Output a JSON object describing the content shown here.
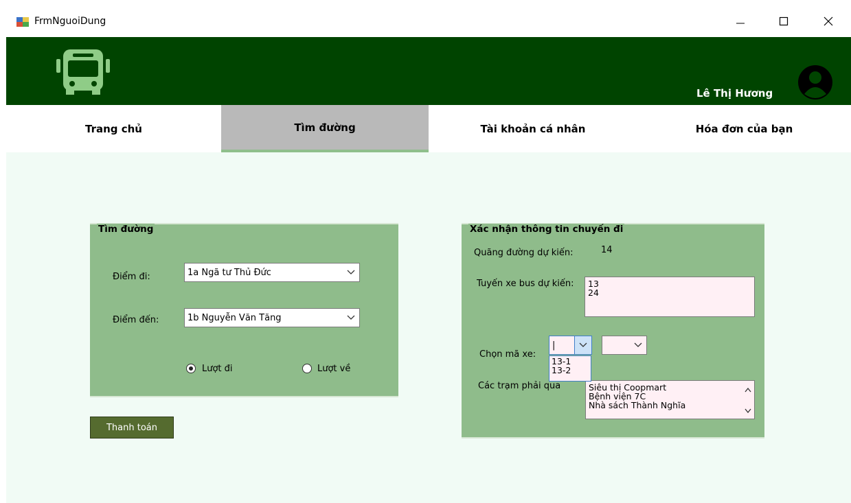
{
  "window": {
    "title": "FrmNguoiDung"
  },
  "header": {
    "user_name": "Lê Thị Hương"
  },
  "nav": {
    "tabs": [
      {
        "label": "Trang chủ"
      },
      {
        "label": "Tìm đường"
      },
      {
        "label": "Tài khoản cá nhân"
      },
      {
        "label": "Hóa đơn của bạn"
      }
    ]
  },
  "search": {
    "title": "Tìm đường",
    "from_label": "Điểm đi:",
    "from_value": "1a Ngã tư Thủ Đức",
    "to_label": "Điểm đến:",
    "to_value": "1b Nguyễn Văn Tăng",
    "outbound_label": "Lượt đi",
    "return_label": "Lượt về"
  },
  "pay_button": "Thanh toán",
  "trip": {
    "title": "Xác nhận thông tin chuyến đi",
    "distance_label": "Quãng đường dự kiến:",
    "distance_value": "14",
    "routes_label": "Tuyến xe bus dự kiến:",
    "routes": [
      "13",
      "24"
    ],
    "bus_code_label": "Chọn mã xe:",
    "bus_code_value": "|",
    "bus_code_options": [
      "13-1",
      "13-2"
    ],
    "stations_label": "Các trạm phải qua",
    "stations": [
      "Siêu thị Coopmart",
      "Bệnh viện 7C",
      "Nhà sách Thành Nghĩa"
    ]
  },
  "colors": {
    "header_bg": "#004400",
    "group_bg": "#8fbc8b",
    "content_bg": "#f1fbf5",
    "button_bg": "#556b2f",
    "active_tab": "#b9b9b9"
  }
}
